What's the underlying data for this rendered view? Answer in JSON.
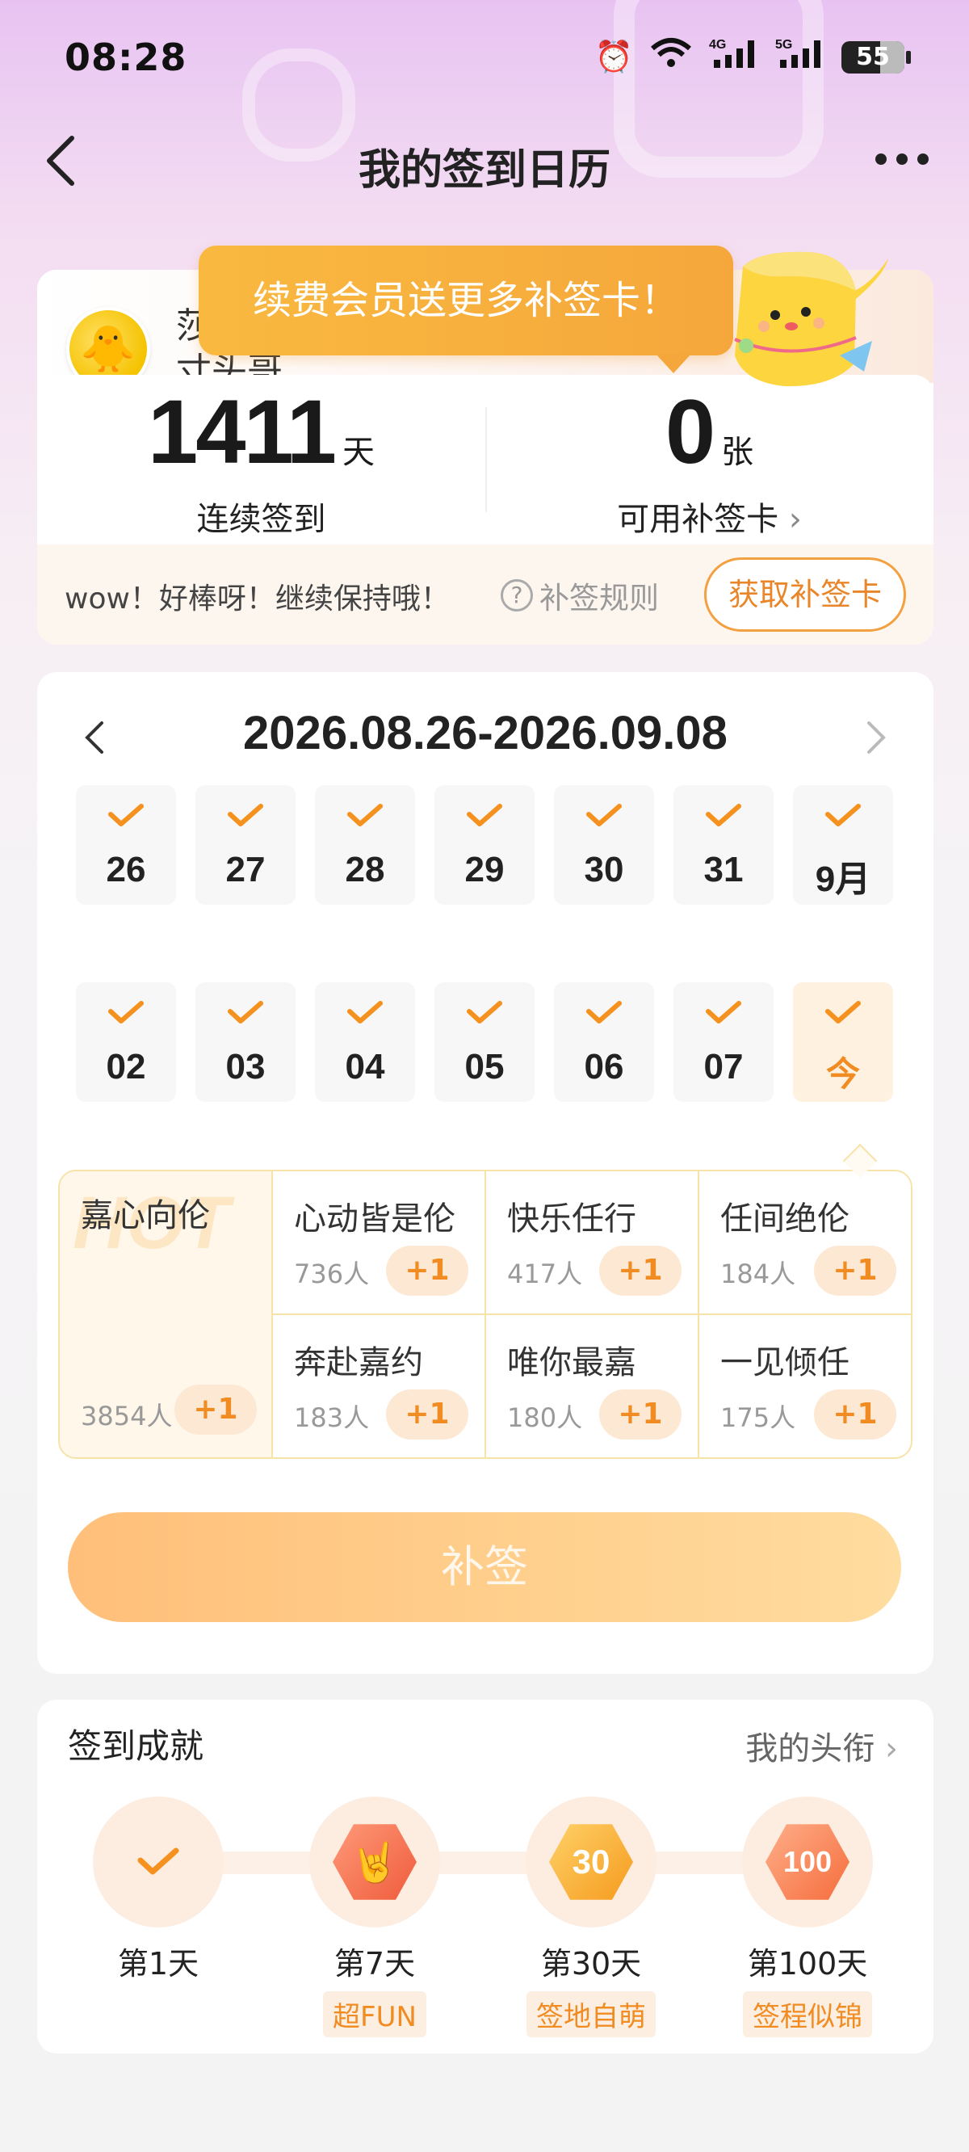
{
  "status_bar": {
    "time": "08:28",
    "battery": "55",
    "icons": [
      "alarm-icon",
      "wifi-icon",
      "signal-4g-icon",
      "signal-5g-icon",
      "battery-icon"
    ],
    "net1": "4G",
    "net2": "5G"
  },
  "nav": {
    "title": "我的签到日历",
    "back_icon": "chevron-left-icon",
    "more_icon": "more-dots-icon"
  },
  "promo": {
    "text": "续费会员送更多补签卡！"
  },
  "profile": {
    "username": "莎\n寸头哥",
    "streak": {
      "value": "1411",
      "unit": "天",
      "label": "连续签到"
    },
    "cards": {
      "value": "0",
      "unit": "张",
      "label": "可用补签卡"
    },
    "praise": "wow！好棒呀！继续保持哦！",
    "rules_label": "补签规则",
    "get_card_label": "获取补签卡"
  },
  "calendar": {
    "range": "2026.08.26-2026.09.08",
    "week1": [
      "26",
      "27",
      "28",
      "29",
      "30",
      "31",
      "9月"
    ],
    "week2": [
      "02",
      "03",
      "04",
      "05",
      "06",
      "07",
      "今"
    ]
  },
  "topics": {
    "hot": {
      "name": "嘉心向伦",
      "count": "3854人",
      "action": "+1",
      "bg_text": "HOT"
    },
    "items": [
      {
        "name": "心动皆是伦",
        "count": "736人",
        "action": "+1"
      },
      {
        "name": "快乐任行",
        "count": "417人",
        "action": "+1"
      },
      {
        "name": "任间绝伦",
        "count": "184人",
        "action": "+1"
      },
      {
        "name": "奔赴嘉约",
        "count": "183人",
        "action": "+1"
      },
      {
        "name": "唯你最嘉",
        "count": "180人",
        "action": "+1"
      },
      {
        "name": "一见倾任",
        "count": "175人",
        "action": "+1"
      }
    ]
  },
  "makeup_button": "补签",
  "achievements": {
    "title": "签到成就",
    "my_titles": "我的头衔",
    "items": [
      {
        "day": "第1天",
        "tag": ""
      },
      {
        "day": "第7天",
        "tag": "超FUN"
      },
      {
        "day": "第30天",
        "tag": "签地自萌"
      },
      {
        "day": "第100天",
        "tag": "签程似锦"
      }
    ]
  },
  "colors": {
    "accent": "#f08c22",
    "promo": "#f5a73b",
    "check": "#f5911e"
  }
}
